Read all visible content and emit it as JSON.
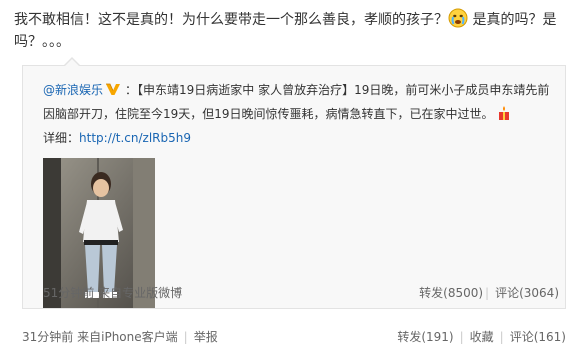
{
  "post": {
    "text_part1": "我不敢相信！这不是真的！为什么要带走一个那么善良，孝顺的孩子？",
    "emoji_icon": "crying-face-icon",
    "text_part2": " 是真的吗？是吗？。。。"
  },
  "repost": {
    "author": "@新浪娱乐",
    "verified_icon": "verified-v-icon",
    "text_part1": "：【申东靖19日病逝家中 家人曾放弃治疗】19日晚，前可米小子成员申东靖先前因脑部开刀，住院至今19天，但19日晚间惊传噩耗，病情急转直下，已在家中过世。",
    "gift_icon": "candle-gift-icon",
    "detail_label": "详细：",
    "detail_link": "http://t.cn/zlRb5h9",
    "time": "51分钟前",
    "source_prefix": "来自",
    "source": "专业版微博",
    "repost_count": "转发(8500)",
    "comment_count": "评论(3064)"
  },
  "footer": {
    "time": "31分钟前",
    "source_prefix": "来自",
    "source": "iPhone客户端",
    "report": "举报",
    "repost": "转发(191)",
    "favorite": "收藏",
    "comment": "评论(161)"
  },
  "colors": {
    "link": "#1a66b3",
    "text": "#333333",
    "muted": "#666666",
    "repost_bg": "#f8f8f8",
    "border": "#e3e3e3"
  }
}
